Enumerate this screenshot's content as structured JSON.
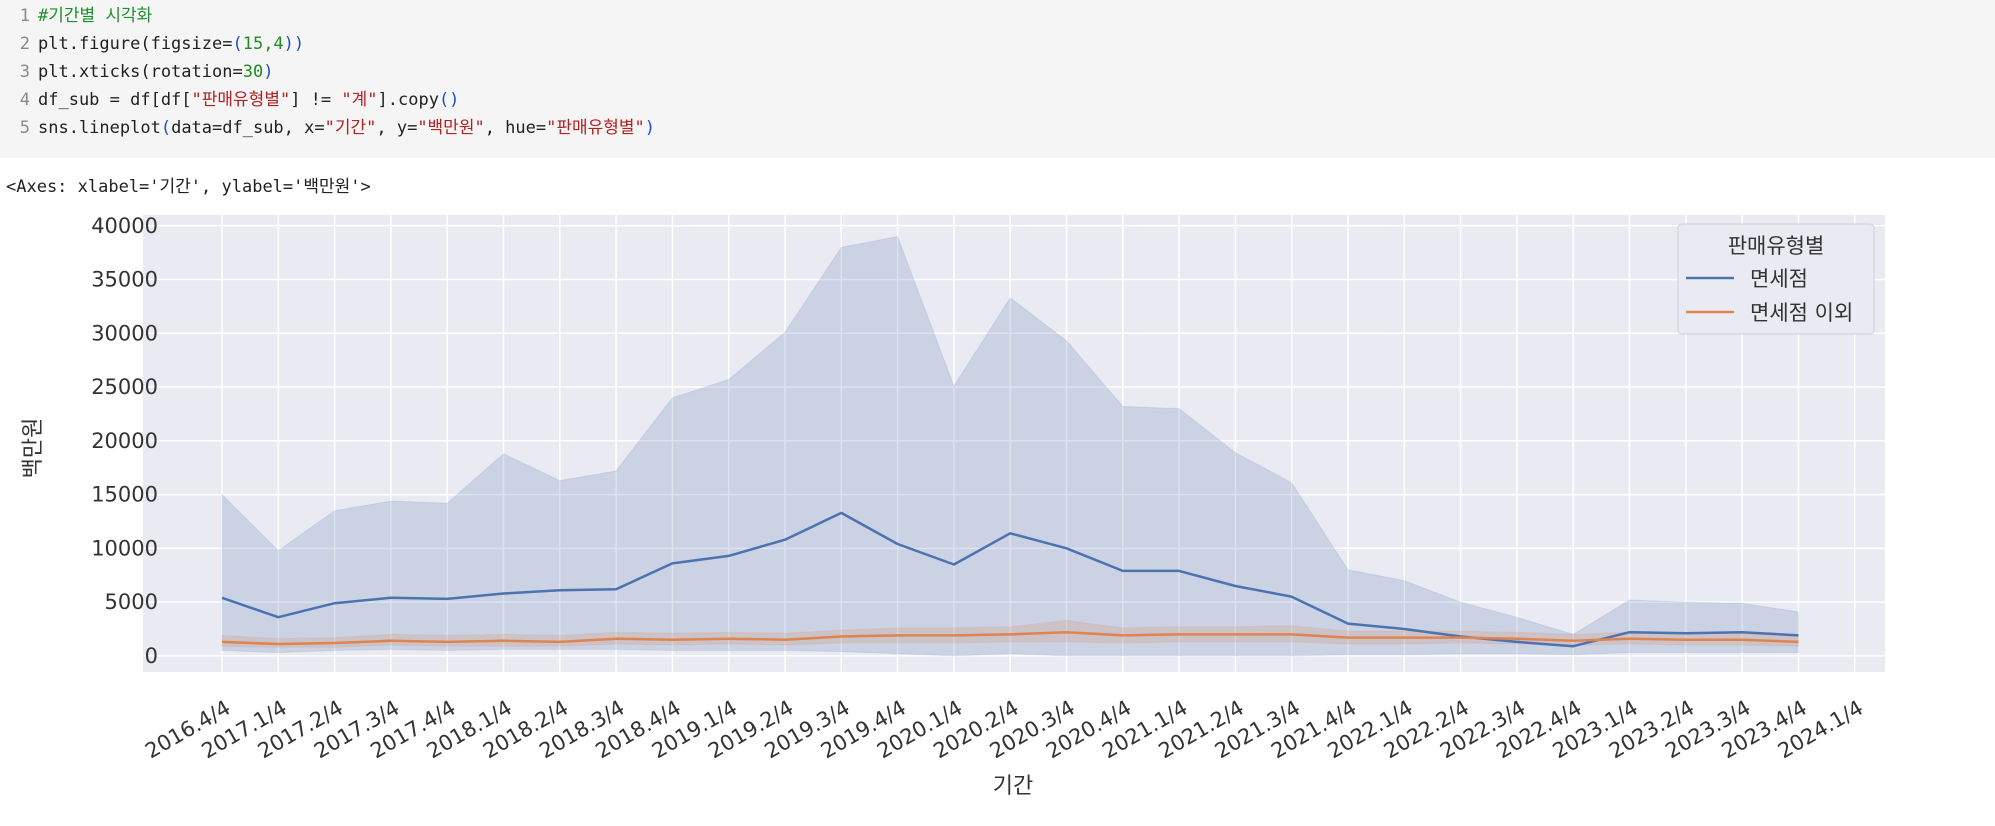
{
  "code": {
    "line_numbers": [
      "1",
      "2",
      "3",
      "4",
      "5"
    ],
    "comment": "#기간별 시각화",
    "l2_a": "plt.figure(figsize=",
    "l2_b": "(",
    "l2_num": "15,4",
    "l2_c": "))",
    "l3_a": "plt.xticks(rotation=",
    "l3_num": "30",
    "l3_c": ")",
    "l4_a": "df_sub = df[df[",
    "l4_s1": "\"판매유형별\"",
    "l4_b": "] != ",
    "l4_s2": "\"계\"",
    "l4_c": "].copy",
    "l4_d": "()",
    "l5_a": "sns.lineplot",
    "l5_b": "(",
    "l5_c": "data=df_sub, x=",
    "l5_s1": "\"기간\"",
    "l5_d": ", y=",
    "l5_s2": "\"백만원\"",
    "l5_e": ", hue=",
    "l5_s3": "\"판매유형별\"",
    "l5_f": ")"
  },
  "output_text": "<Axes: xlabel='기간', ylabel='백만원'>",
  "chart_data": {
    "type": "line",
    "xlabel": "기간",
    "ylabel": "백만원",
    "ylim": [
      -1500,
      41000
    ],
    "yticks": [
      0,
      5000,
      10000,
      15000,
      20000,
      25000,
      30000,
      35000,
      40000
    ],
    "grid": true,
    "legend_title": "판매유형별",
    "legend_position": "top-right",
    "categories": [
      "2016.4/4",
      "2017.1/4",
      "2017.2/4",
      "2017.3/4",
      "2017.4/4",
      "2018.1/4",
      "2018.2/4",
      "2018.3/4",
      "2018.4/4",
      "2019.1/4",
      "2019.2/4",
      "2019.3/4",
      "2019.4/4",
      "2020.1/4",
      "2020.2/4",
      "2020.3/4",
      "2020.4/4",
      "2021.1/4",
      "2021.2/4",
      "2021.3/4",
      "2021.4/4",
      "2022.1/4",
      "2022.2/4",
      "2022.3/4",
      "2022.4/4",
      "2023.1/4",
      "2023.2/4",
      "2023.3/4",
      "2023.4/4",
      "2024.1/4"
    ],
    "series": [
      {
        "name": "면세점",
        "color": "#4c72b0",
        "values": [
          5400,
          3600,
          4900,
          5400,
          5300,
          5800,
          6100,
          6200,
          8600,
          9300,
          10800,
          13300,
          10400,
          8500,
          11400,
          10000,
          7900,
          7900,
          6500,
          5500,
          3000,
          2500,
          1800,
          1300,
          900,
          2200,
          2100,
          2200,
          1900,
          null
        ],
        "ci_low": [
          500,
          300,
          500,
          600,
          500,
          600,
          600,
          600,
          500,
          500,
          500,
          400,
          200,
          0,
          200,
          0,
          0,
          0,
          0,
          0,
          100,
          100,
          200,
          200,
          100,
          300,
          300,
          300,
          300,
          null
        ],
        "ci_high": [
          15000,
          9800,
          13500,
          14400,
          14200,
          18800,
          16300,
          17200,
          24000,
          25700,
          30100,
          38000,
          39000,
          25100,
          33300,
          29300,
          23200,
          23000,
          18900,
          16100,
          8000,
          7000,
          5000,
          3600,
          2000,
          5200,
          5000,
          4900,
          4100,
          null
        ]
      },
      {
        "name": "면세점 이외",
        "color": "#dd8452",
        "values": [
          1300,
          1100,
          1200,
          1400,
          1300,
          1400,
          1300,
          1600,
          1500,
          1600,
          1500,
          1800,
          1900,
          1900,
          2000,
          2200,
          1900,
          2000,
          2000,
          2000,
          1700,
          1700,
          1700,
          1600,
          1400,
          1600,
          1500,
          1500,
          1300,
          null
        ],
        "ci_low": [
          900,
          800,
          800,
          1000,
          900,
          900,
          900,
          1100,
          1000,
          1100,
          1000,
          1200,
          1200,
          1200,
          1300,
          1300,
          1200,
          1300,
          1300,
          1300,
          1100,
          1100,
          1200,
          1100,
          1000,
          1100,
          1000,
          1000,
          900,
          null
        ],
        "ci_high": [
          1900,
          1600,
          1700,
          2000,
          1900,
          2000,
          1900,
          2200,
          2100,
          2200,
          2100,
          2400,
          2600,
          2600,
          2700,
          3300,
          2600,
          2700,
          2700,
          2800,
          2300,
          2300,
          2300,
          2200,
          2000,
          2200,
          2100,
          2100,
          1800,
          null
        ]
      }
    ]
  }
}
